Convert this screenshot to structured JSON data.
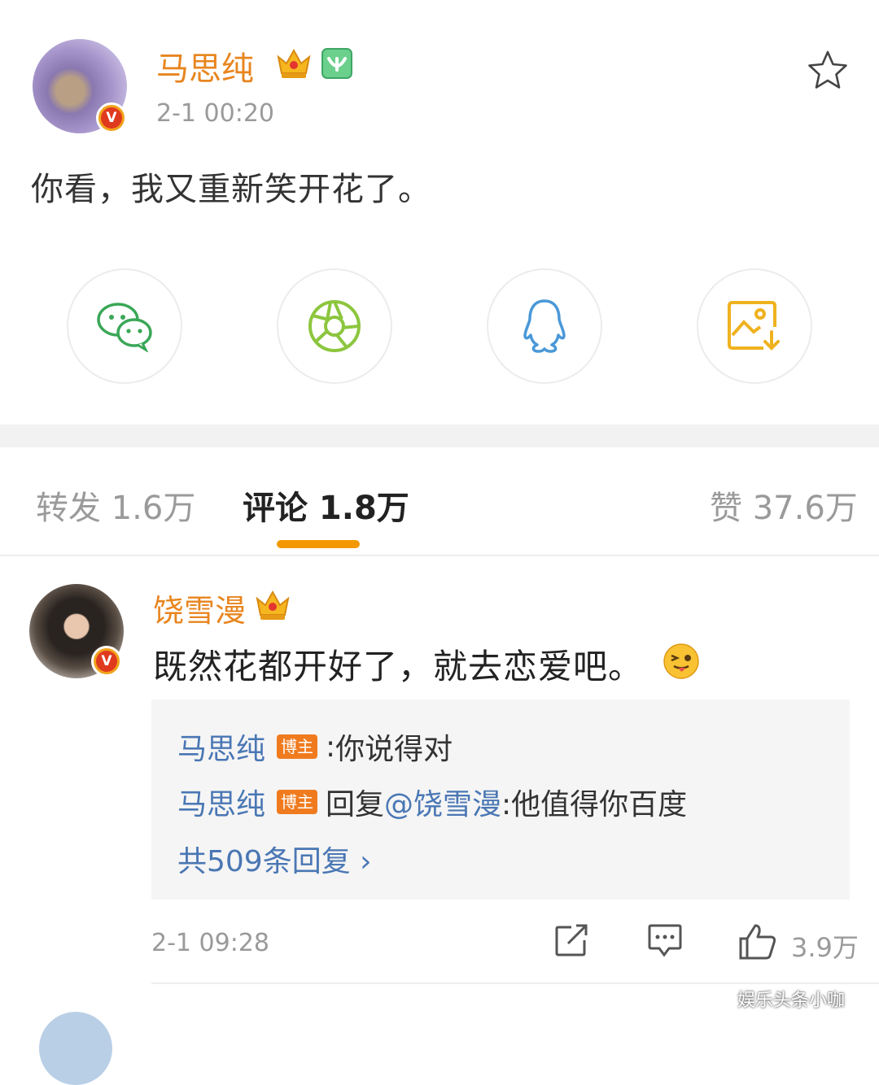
{
  "post": {
    "author": "马思纯",
    "time": "2-1 00:20",
    "text": "你看，我又重新笑开花了。",
    "verified_mark": "V"
  },
  "share": {
    "items": [
      "wechat-icon",
      "moments-icon",
      "qq-icon",
      "save-image-icon"
    ]
  },
  "tabs": {
    "repost": "转发 1.6万",
    "comments": "评论 1.8万",
    "likes": "赞 37.6万"
  },
  "comment": {
    "author": "饶雪漫",
    "text": "既然花都开好了，就去恋爱吧。",
    "time": "2-1 09:28",
    "likes": "3.9万",
    "verified_mark": "V",
    "replies": [
      {
        "author": "马思纯",
        "tag": "博主",
        "sep": ":",
        "text": " 你说得对"
      },
      {
        "author": "马思纯",
        "tag": "博主",
        "prefix": "回复",
        "mention": "@饶雪漫",
        "text": ":他值得你百度"
      }
    ],
    "more_replies": "共509条回复 ›"
  },
  "watermark": "娱乐头条小咖",
  "colors": {
    "name": "#e8851f",
    "link": "#4a77b4",
    "accent": "#f39800",
    "tag": "#f07b1f"
  }
}
